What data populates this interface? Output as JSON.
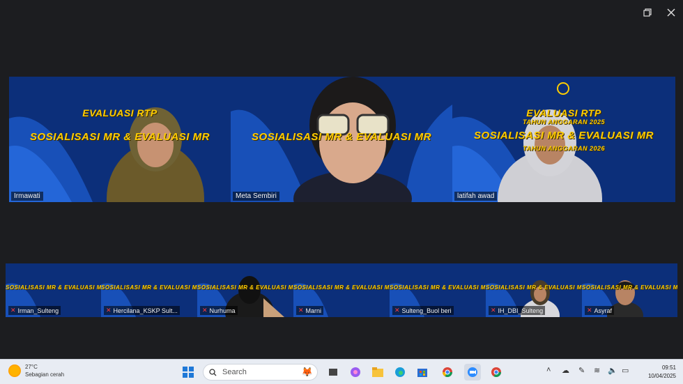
{
  "window": {
    "restore_icon": "restore-icon",
    "close_icon": "close-icon"
  },
  "banner": {
    "line1": "EVALUASI RTP",
    "line2": "TAHUN ANGGARAN 2025",
    "line3": "SOSIALISASI MR & EVALUASI MR",
    "line4": "TAHUN ANGGARAN 2026"
  },
  "main_tiles": [
    {
      "name": "Irmawati"
    },
    {
      "name": "Meta Sembiri"
    },
    {
      "name": "latifah awad"
    }
  ],
  "small_tiles": [
    {
      "name": "Irman_Sulteng"
    },
    {
      "name": "Hercilana_KSKP Sult..."
    },
    {
      "name": "Nurhuma"
    },
    {
      "name": "Marni"
    },
    {
      "name": "Sulteng_Buol beri"
    },
    {
      "name": "IH_DBI_Sulteng"
    },
    {
      "name": "Asyraf"
    }
  ],
  "taskbar": {
    "weather_temp": "27°C",
    "weather_desc": "Sebagian cerah",
    "search_placeholder": "Search",
    "time": "09:51",
    "date": "10/04/2025"
  },
  "colors": {
    "active_border": "#2ad15b",
    "bg": "#1c1d20",
    "banner_text": "#ffcd00"
  }
}
